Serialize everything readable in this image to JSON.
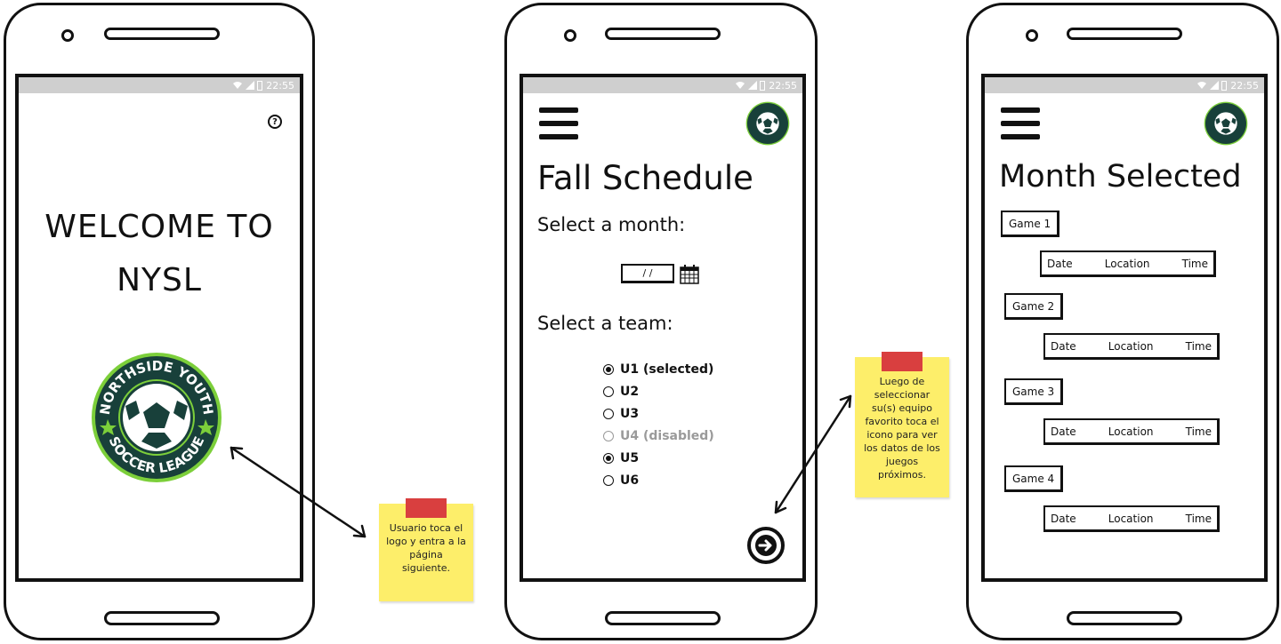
{
  "statusbar": {
    "time": "22:55"
  },
  "screen1": {
    "title_line1": "WELCOME TO",
    "title_line2": "NYSL",
    "help_glyph": "?"
  },
  "logo": {
    "top_text": "NORTHSIDE YOUTH",
    "bottom_text": "SOCCER LEAGUE"
  },
  "screen2": {
    "title": "Fall Schedule",
    "month_label": "Select a month:",
    "date_value": "/ /",
    "team_label": "Select a team:",
    "teams": [
      {
        "label": "U1 (selected)",
        "checked": true,
        "disabled": false
      },
      {
        "label": "U2",
        "checked": false,
        "disabled": false
      },
      {
        "label": "U3",
        "checked": false,
        "disabled": false
      },
      {
        "label": "U4 (disabled)",
        "checked": false,
        "disabled": true
      },
      {
        "label": "U5",
        "checked": true,
        "disabled": false
      },
      {
        "label": "U6",
        "checked": false,
        "disabled": false
      }
    ]
  },
  "screen3": {
    "title": "Month Selected",
    "games": [
      {
        "label": "Game 1",
        "date": "Date",
        "location": "Location",
        "time": "Time"
      },
      {
        "label": "Game 2",
        "date": "Date",
        "location": "Location",
        "time": "Time"
      },
      {
        "label": "Game 3",
        "date": "Date",
        "location": "Location",
        "time": "Time"
      },
      {
        "label": "Game 4",
        "date": "Date",
        "location": "Location",
        "time": "Time"
      }
    ]
  },
  "notes": {
    "note1": "Usuario toca el logo y entra a la página siguiente.",
    "note2": "Luego de seleccionar su(s) equipo favorito toca el icono para ver los datos de los juegos próximos."
  },
  "colors": {
    "logo_green": "#1f8a3c",
    "logo_dark": "#18403a",
    "logo_star": "#7ccf3a",
    "sticky_yellow": "#fdee6a",
    "tape_red": "#d93f3f",
    "statusbar_gray": "#cfcfcf"
  }
}
